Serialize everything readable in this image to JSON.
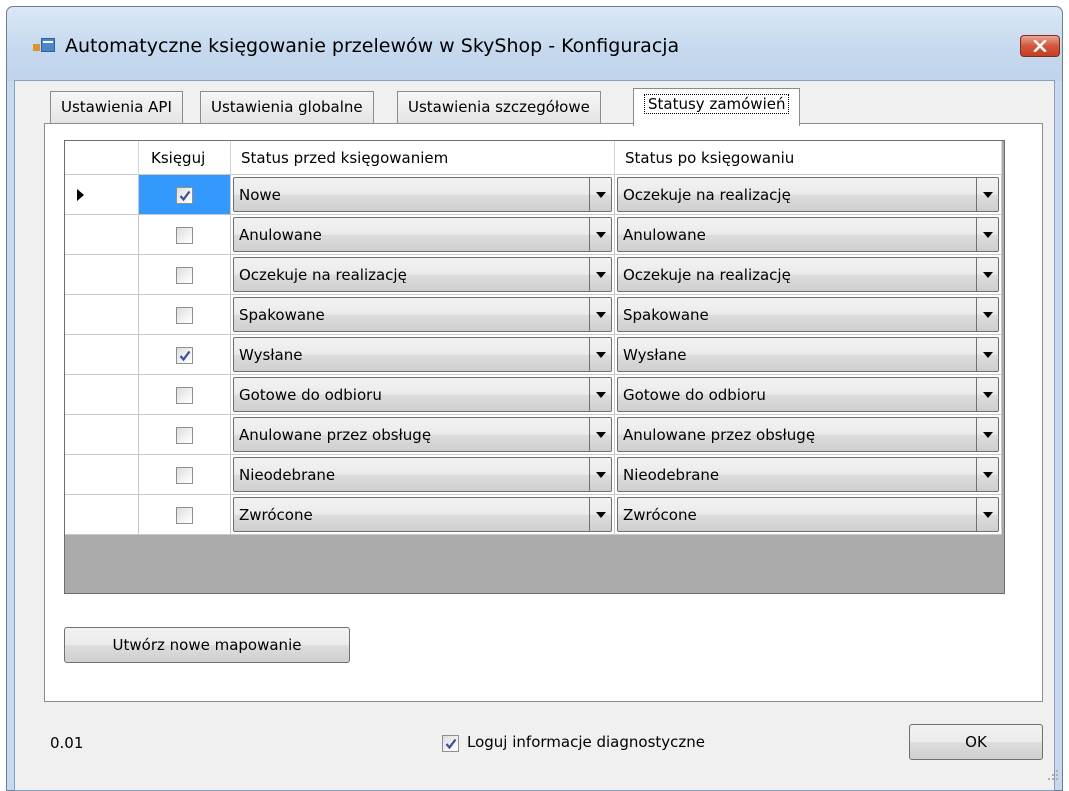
{
  "window": {
    "title": "Automatyczne księgowanie przelewów w SkyShop - Konfiguracja"
  },
  "tabs": [
    {
      "label": "Ustawienia API",
      "active": false
    },
    {
      "label": "Ustawienia globalne",
      "active": false
    },
    {
      "label": "Ustawienia szczegółowe",
      "active": false
    },
    {
      "label": "Statusy zamówień",
      "active": true
    }
  ],
  "grid": {
    "columns": {
      "check": "Księguj",
      "before": "Status przed księgowaniem",
      "after": "Status po księgowaniu"
    },
    "rows": [
      {
        "checked": true,
        "before": "Nowe",
        "after": "Oczekuje na realizację"
      },
      {
        "checked": false,
        "before": "Anulowane",
        "after": "Anulowane"
      },
      {
        "checked": false,
        "before": "Oczekuje na realizację",
        "after": "Oczekuje na realizację"
      },
      {
        "checked": false,
        "before": "Spakowane",
        "after": "Spakowane"
      },
      {
        "checked": true,
        "before": "Wysłane",
        "after": "Wysłane"
      },
      {
        "checked": false,
        "before": "Gotowe do odbioru",
        "after": "Gotowe do odbioru"
      },
      {
        "checked": false,
        "before": "Anulowane przez obsługę",
        "after": "Anulowane przez obsługę"
      },
      {
        "checked": false,
        "before": "Nieodebrane",
        "after": "Nieodebrane"
      },
      {
        "checked": false,
        "before": "Zwrócone",
        "after": "Zwrócone"
      }
    ]
  },
  "buttons": {
    "new_mapping": "Utwórz nowe mapowanie",
    "ok": "OK"
  },
  "footer": {
    "version": "0.01",
    "diagnostics_label": "Loguj informacje diagnostyczne",
    "diagnostics_checked": true
  },
  "colors": {
    "selection": "#3399ff",
    "grid_background": "#aaaaaa",
    "close_button": "#c43f1e"
  }
}
